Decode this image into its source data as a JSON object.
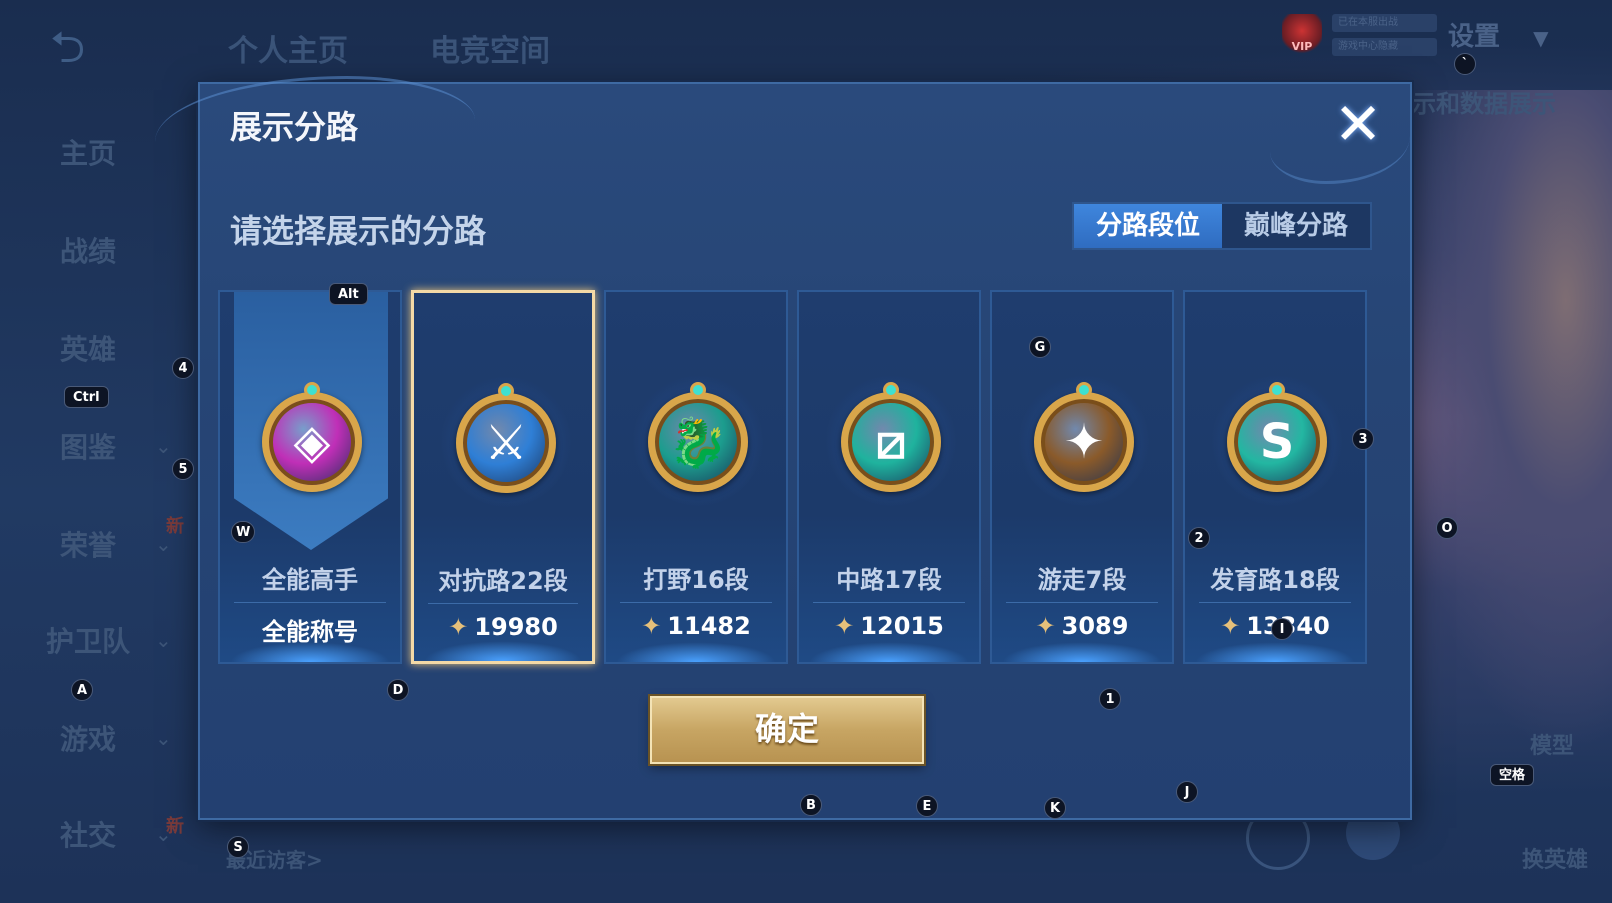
{
  "background": {
    "top_tabs": [
      "个人主页",
      "电竞空间"
    ],
    "sidebar": [
      {
        "label": "主页",
        "chevron": false
      },
      {
        "label": "战绩",
        "chevron": false
      },
      {
        "label": "英雄",
        "chevron": false
      },
      {
        "label": "图鉴",
        "chevron": true
      },
      {
        "label": "荣誉",
        "chevron": true
      },
      {
        "label": "护卫队",
        "chevron": true
      },
      {
        "label": "游戏",
        "chevron": true
      },
      {
        "label": "社交",
        "chevron": true
      }
    ],
    "new_badge": "新",
    "settings_label": "设置",
    "vip_label": "VIP",
    "top_status_1": "已在本服出战",
    "top_status_2": "游戏中心隐藏",
    "right_partial_text": "示和数据展示",
    "model_label": "模型",
    "switch_hero_label": "换英雄",
    "recent_visitors": "最近访客>"
  },
  "dialog": {
    "title": "展示分路",
    "close_icon": "close-icon",
    "subtitle": "请选择展示的分路",
    "tabs": [
      {
        "label": "分路段位",
        "active": true
      },
      {
        "label": "巅峰分路",
        "active": false
      }
    ],
    "cards": [
      {
        "name": "全能高手",
        "value": "全能称号",
        "emblem": "◈",
        "emblem_color": "#c02fb7",
        "has_banner": true,
        "selected": false,
        "show_score_icon": false
      },
      {
        "name": "对抗路22段",
        "value": "19980",
        "emblem": "⚔",
        "emblem_color": "#2f7fd6",
        "has_banner": false,
        "selected": true,
        "show_score_icon": true
      },
      {
        "name": "打野16段",
        "value": "11482",
        "emblem": "🐉",
        "emblem_color": "#1c9d8e",
        "has_banner": false,
        "selected": false,
        "show_score_icon": true
      },
      {
        "name": "中路17段",
        "value": "12015",
        "emblem": "⧄",
        "emblem_color": "#1fb39e",
        "has_banner": false,
        "selected": false,
        "show_score_icon": true
      },
      {
        "name": "游走7段",
        "value": "3089",
        "emblem": "✦",
        "emblem_color": "#8a5a2a",
        "has_banner": false,
        "selected": false,
        "show_score_icon": true
      },
      {
        "name": "发育路18段",
        "value": "13340",
        "emblem": "S",
        "emblem_color": "#23b7a2",
        "has_banner": false,
        "selected": false,
        "show_score_icon": true
      }
    ],
    "score_icon": "✦",
    "confirm_label": "确定"
  },
  "hints": [
    {
      "key": "Alt"
    },
    {
      "key": "4"
    },
    {
      "key": "Ctrl"
    },
    {
      "key": "5"
    },
    {
      "key": "W"
    },
    {
      "key": "A"
    },
    {
      "key": "D"
    },
    {
      "key": "G"
    },
    {
      "key": "3"
    },
    {
      "key": "2"
    },
    {
      "key": "I"
    },
    {
      "key": "1"
    },
    {
      "key": "O"
    },
    {
      "key": "`"
    },
    {
      "key": "空格"
    },
    {
      "key": "J"
    },
    {
      "key": "B"
    },
    {
      "key": "E"
    },
    {
      "key": "K"
    },
    {
      "key": "S"
    }
  ],
  "colors": {
    "accent_blue": "#3f86dd",
    "gold": "#c7a563",
    "selected_border": "#f3d9a6"
  }
}
